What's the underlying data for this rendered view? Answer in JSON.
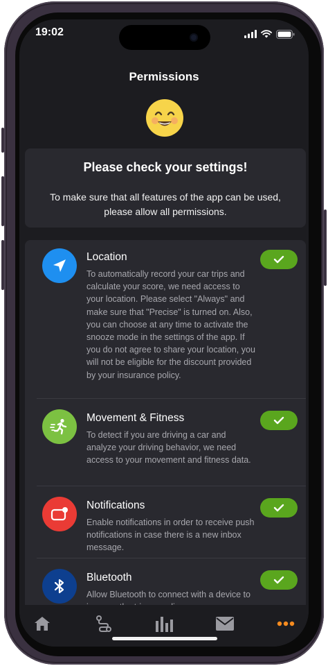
{
  "status_bar": {
    "time": "19:02"
  },
  "header": {
    "title": "Permissions"
  },
  "intro": {
    "title": "Please check your settings!",
    "text": "To make sure that all features of the app can be used, please allow all permissions."
  },
  "permissions": [
    {
      "title": "Location",
      "description": "To automatically record your car trips and calculate your score, we need access to your location. Please select \"Always\" and make sure that \"Precise\" is turned on. Also, you can choose at any time to activate the snooze mode in the settings of the app. If you do not agree to share your location, you will not be eligible for the discount provided by your insurance policy.",
      "granted": true,
      "icon": "location-arrow-icon",
      "color": "#1e8ff0"
    },
    {
      "title": "Movement & Fitness",
      "description": "To detect if you are driving a car and analyze your driving behavior, we need access to your movement and fitness data.",
      "granted": true,
      "icon": "running-person-icon",
      "color": "#7cc142"
    },
    {
      "title": "Notifications",
      "description": "Enable notifications in order to receive push notifications in case there is a new inbox message.",
      "granted": true,
      "icon": "notification-badge-icon",
      "color": "#ea3b35"
    },
    {
      "title": "Bluetooth",
      "description": "Allow Bluetooth to connect with a device to improve the trip recording.",
      "granted": true,
      "icon": "bluetooth-icon",
      "color": "#0d3f8f"
    }
  ],
  "tabbar": {
    "items": [
      "home-icon",
      "route-icon",
      "statistics-icon",
      "mail-icon",
      "more-icon"
    ],
    "active_color": "#f68b1f",
    "inactive_color": "#9a9aa0"
  },
  "colors": {
    "background": "#1c1c20",
    "card": "#29292f",
    "toggle_on": "#5aa61e"
  }
}
